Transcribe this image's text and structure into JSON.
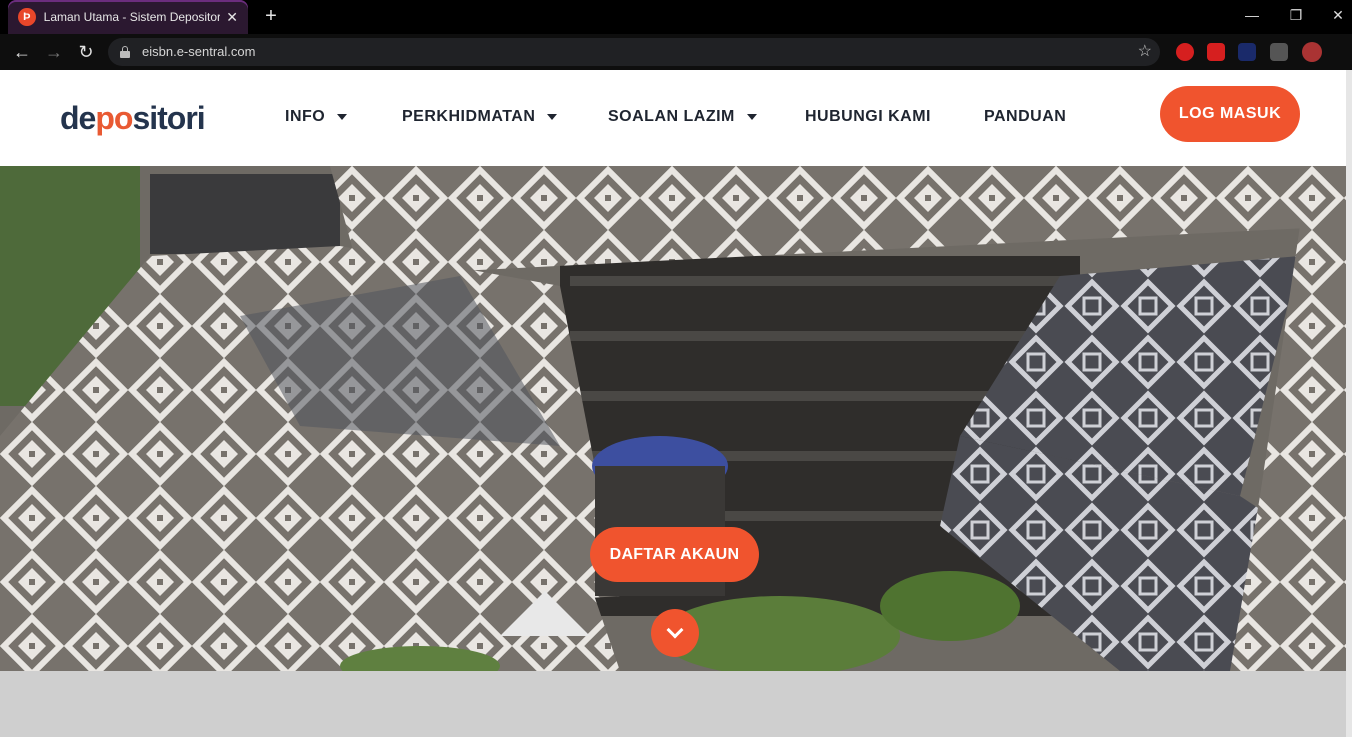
{
  "browser": {
    "tab_title": "Laman Utama - Sistem Depositori",
    "tab_favicon": "Þ",
    "tab_close": "✕",
    "new_tab": "+",
    "url": "eisbn.e-sentral.com",
    "window_controls": {
      "minimize": "—",
      "restore": "❐",
      "close": "✕"
    },
    "nav": {
      "back": "←",
      "forward": "→",
      "reload": "↻"
    },
    "star": "☆",
    "extensions": [
      "adblock-icon",
      "video-icon",
      "search-ext-icon",
      "puzzle-icon",
      "profile-avatar"
    ]
  },
  "site": {
    "logo_pre": "de",
    "logo_accent": "po",
    "logo_post": "sitori",
    "nav": [
      {
        "label": "INFO",
        "dropdown": true
      },
      {
        "label": "PERKHIDMATAN",
        "dropdown": true
      },
      {
        "label": "SOALAN LAZIM",
        "dropdown": true
      },
      {
        "label": "HUBUNGI KAMI",
        "dropdown": false
      },
      {
        "label": "PANDUAN",
        "dropdown": false
      }
    ],
    "login_label": "LOG MASUK",
    "register_label": "DAFTAR AKAUN",
    "scroll_down_icon": "chevron-down-icon",
    "accent_color": "#f0542e",
    "brand_color": "#24344d"
  }
}
